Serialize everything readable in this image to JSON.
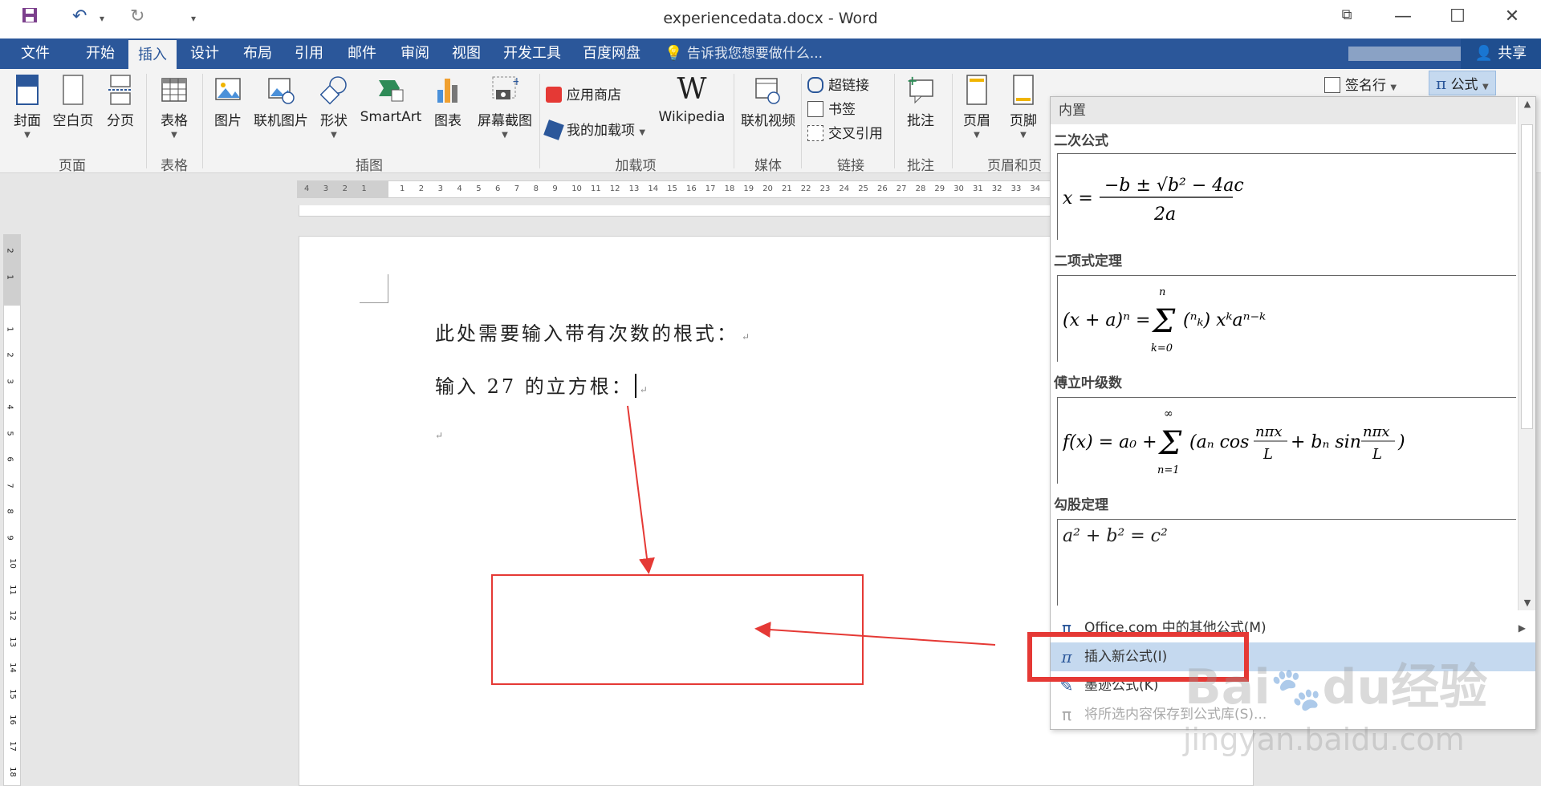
{
  "window": {
    "title": "experiencedata.docx - Word",
    "controls": {
      "restore": "⧉",
      "minimize": "—",
      "maximize": "☐",
      "close": "✕"
    }
  },
  "quick_access": {
    "save": "💾",
    "undo": "↶",
    "undo_dropdown": "▾",
    "redo": "↻",
    "customize": "▾"
  },
  "tabs": [
    "文件",
    "开始",
    "插入",
    "设计",
    "布局",
    "引用",
    "邮件",
    "审阅",
    "视图",
    "开发工具",
    "百度网盘"
  ],
  "active_tab": "插入",
  "tell_me": "告诉我您想要做什么...",
  "share": "共享",
  "ribbon": {
    "pages": {
      "cover": "封面",
      "blank": "空白页",
      "break": "分页",
      "group": "页面"
    },
    "tables": {
      "table": "表格",
      "group": "表格"
    },
    "illustrations": {
      "picture": "图片",
      "online_picture": "联机图片",
      "shapes": "形状",
      "smartart": "SmartArt",
      "chart": "图表",
      "screenshot": "屏幕截图",
      "group": "插图"
    },
    "addins": {
      "store": "应用商店",
      "my_addins": "我的加载项",
      "wikipedia": "Wikipedia",
      "group": "加载项"
    },
    "media": {
      "online_video": "联机视频",
      "group": "媒体"
    },
    "links": {
      "hyperlink": "超链接",
      "bookmark": "书签",
      "cross_ref": "交叉引用",
      "group": "链接"
    },
    "comments": {
      "comment": "批注",
      "group": "批注"
    },
    "header_footer": {
      "header": "页眉",
      "footer": "页脚",
      "group": "页眉和页"
    },
    "right": {
      "signature": "签名行",
      "equation": "公式"
    }
  },
  "ruler": {
    "h_ticks": [
      "4",
      "3",
      "2",
      "1",
      "",
      "1",
      "2",
      "3",
      "4",
      "5",
      "6",
      "7",
      "8",
      "9",
      "10",
      "11",
      "12",
      "13",
      "14",
      "15",
      "16",
      "17",
      "18",
      "19",
      "20",
      "21",
      "22",
      "23",
      "24",
      "25",
      "26",
      "27",
      "28",
      "29",
      "30",
      "31",
      "32",
      "33",
      "34"
    ],
    "v_ticks": [
      "2",
      "1",
      "",
      "1",
      "2",
      "3",
      "4",
      "5",
      "6",
      "7",
      "8",
      "9",
      "10",
      "11",
      "12",
      "13",
      "14",
      "15",
      "16",
      "17",
      "18"
    ]
  },
  "document": {
    "line1": "此处需要输入带有次数的根式：",
    "line2": "输入 27 的立方根：",
    "para_mark": "↵"
  },
  "equation_menu": {
    "header": "内置",
    "sections": [
      {
        "title": "二次公式"
      },
      {
        "title": "二项式定理"
      },
      {
        "title": "傅立叶级数"
      },
      {
        "title": "勾股定理"
      }
    ],
    "items": [
      {
        "label": "Office.com 中的其他公式(M)",
        "icon": "π"
      },
      {
        "label": "插入新公式(I)",
        "icon": "π"
      },
      {
        "label": "墨迹公式(K)",
        "icon": "✎"
      },
      {
        "label": "将所选内容保存到公式库(S)...",
        "icon": "π"
      }
    ]
  },
  "watermark": {
    "logo": "Bai",
    "logo2": "du",
    "cn": "经验",
    "url": "jingyan.baidu.com"
  },
  "colors": {
    "accent": "#2b579a",
    "annotation": "#e53935"
  }
}
